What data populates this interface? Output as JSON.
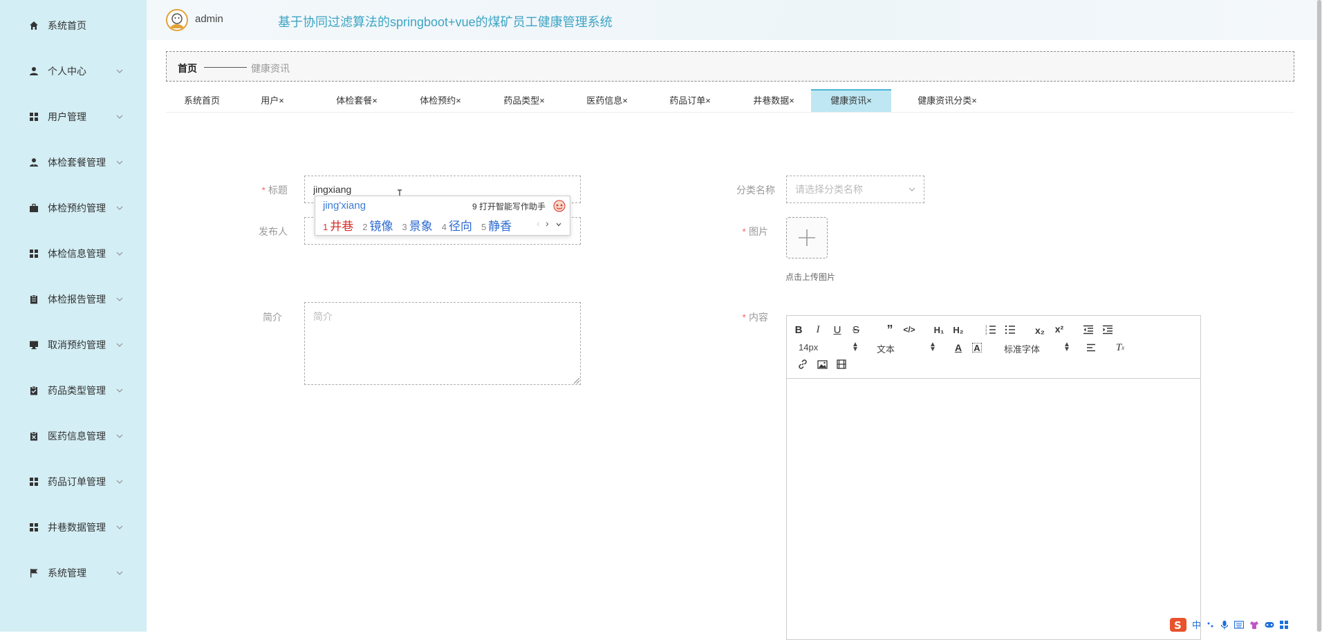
{
  "sidebar": {
    "items": [
      {
        "label": "系统首页",
        "icon": "home-icon"
      },
      {
        "label": "个人中心",
        "icon": "user-icon"
      },
      {
        "label": "用户管理",
        "icon": "grid-icon"
      },
      {
        "label": "体检套餐管理",
        "icon": "user-tie-icon"
      },
      {
        "label": "体检预约管理",
        "icon": "briefcase-icon"
      },
      {
        "label": "体检信息管理",
        "icon": "grid-icon"
      },
      {
        "label": "体检报告管理",
        "icon": "clipboard-icon"
      },
      {
        "label": "取消预约管理",
        "icon": "monitor-icon"
      },
      {
        "label": "药品类型管理",
        "icon": "clipboard-check-icon"
      },
      {
        "label": "医药信息管理",
        "icon": "clipboard-x-icon"
      },
      {
        "label": "药品订单管理",
        "icon": "grid-icon"
      },
      {
        "label": "井巷数据管理",
        "icon": "grid-icon"
      },
      {
        "label": "系统管理",
        "icon": "flag-icon"
      }
    ]
  },
  "header": {
    "username": "admin",
    "title": "基于协同过滤算法的springboot+vue的煤矿员工健康管理系统"
  },
  "breadcrumb": {
    "home": "首页",
    "current": "健康资讯"
  },
  "tabs": [
    {
      "label": "系统首页"
    },
    {
      "label": "用户×"
    },
    {
      "label": "体检套餐×"
    },
    {
      "label": "体检预约×"
    },
    {
      "label": "药品类型×"
    },
    {
      "label": "医药信息×"
    },
    {
      "label": "药品订单×"
    },
    {
      "label": "井巷数据×"
    },
    {
      "label": "健康资讯×"
    },
    {
      "label": "健康资讯分类×"
    }
  ],
  "active_tab": 8,
  "form": {
    "title_label": "标题",
    "title_value": "jingxiang",
    "category_label": "分类名称",
    "category_placeholder": "请选择分类名称",
    "publisher_label": "发布人",
    "image_label": "图片",
    "upload_tip": "点击上传图片",
    "intro_label": "简介",
    "intro_placeholder": "简介",
    "content_label": "内容"
  },
  "editor": {
    "font_size": "14px",
    "block_type": "文本",
    "font_family": "标准字体"
  },
  "ime": {
    "pinyin": "jing'xiang",
    "assistant_tip": "9 打开智能写作助手",
    "candidates": [
      {
        "num": "1",
        "text": "井巷"
      },
      {
        "num": "2",
        "text": "镜像"
      },
      {
        "num": "3",
        "text": "景象"
      },
      {
        "num": "4",
        "text": "径向"
      },
      {
        "num": "5",
        "text": "静香"
      }
    ]
  },
  "tray": {
    "lang": "中"
  },
  "colors": {
    "sidebar_bg": "#d3eef4",
    "title_color": "#3ea4c4",
    "active_tab_bg": "#bfe7f3",
    "required": "#f56c6c"
  }
}
